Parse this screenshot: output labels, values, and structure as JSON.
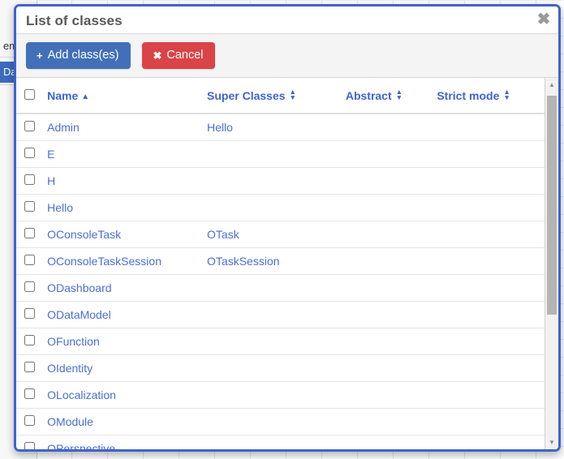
{
  "background": {
    "tree_items": [
      {
        "label": "em",
        "selected": false
      },
      {
        "label": "Dat",
        "selected": true
      }
    ]
  },
  "modal": {
    "title": "List of classes",
    "close_icon": "✖",
    "toolbar": {
      "add_icon": "+",
      "add_label": "Add class(es)",
      "cancel_icon": "✖",
      "cancel_label": "Cancel"
    },
    "table": {
      "columns": [
        {
          "key": "check",
          "label": "",
          "sort": "none"
        },
        {
          "key": "name",
          "label": "Name",
          "sort": "asc"
        },
        {
          "key": "super",
          "label": "Super Classes",
          "sort": "both"
        },
        {
          "key": "abs",
          "label": "Abstract",
          "sort": "both"
        },
        {
          "key": "strict",
          "label": "Strict mode",
          "sort": "both"
        }
      ],
      "sort_asc_glyph": "▲",
      "sort_up_glyph": "▲",
      "sort_down_glyph": "▼",
      "rows": [
        {
          "name": "Admin",
          "super": "Hello",
          "abstract": "",
          "strict": ""
        },
        {
          "name": "E",
          "super": "",
          "abstract": "",
          "strict": ""
        },
        {
          "name": "H",
          "super": "",
          "abstract": "",
          "strict": ""
        },
        {
          "name": "Hello",
          "super": "",
          "abstract": "",
          "strict": ""
        },
        {
          "name": "OConsoleTask",
          "super": "OTask",
          "abstract": "",
          "strict": ""
        },
        {
          "name": "OConsoleTaskSession",
          "super": "OTaskSession",
          "abstract": "",
          "strict": ""
        },
        {
          "name": "ODashboard",
          "super": "",
          "abstract": "",
          "strict": ""
        },
        {
          "name": "ODataModel",
          "super": "",
          "abstract": "",
          "strict": ""
        },
        {
          "name": "OFunction",
          "super": "",
          "abstract": "",
          "strict": ""
        },
        {
          "name": "OIdentity",
          "super": "",
          "abstract": "",
          "strict": ""
        },
        {
          "name": "OLocalization",
          "super": "",
          "abstract": "",
          "strict": ""
        },
        {
          "name": "OModule",
          "super": "",
          "abstract": "",
          "strict": ""
        },
        {
          "name": "OPerspective",
          "super": "",
          "abstract": "",
          "strict": ""
        }
      ]
    },
    "scrollbar": {
      "up_glyph": "▲",
      "down_glyph": "▼"
    }
  },
  "colors": {
    "modal_border": "#3f63cf",
    "primary_button": "#4270b8",
    "danger_button": "#da4347",
    "link": "#4a6fd6",
    "header_link": "#3f63cf",
    "title_text": "#585858",
    "toolbar_bg": "#f4f4f4"
  }
}
